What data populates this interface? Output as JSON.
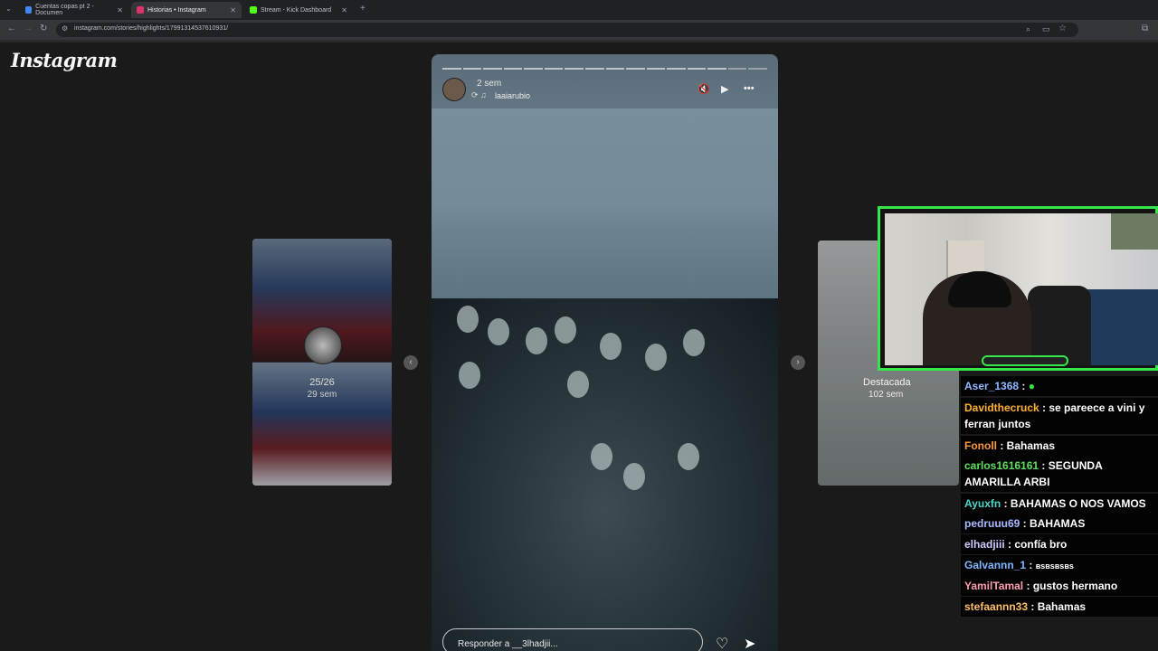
{
  "browser": {
    "tabs": [
      {
        "label": "Cuentas copas pt 2 - Documen",
        "favicon_color": "#4285f4"
      },
      {
        "label": "Historias • Instagram",
        "favicon_color": "#e1306c"
      },
      {
        "label": "Stream - Kick Dashboard",
        "favicon_color": "#53fc18"
      }
    ],
    "url": "instagram.com/stories/highlights/17991314537610931/"
  },
  "instagram": {
    "logo": "Instagram",
    "prev_story": {
      "count": "25/26",
      "time": "29 sem"
    },
    "story": {
      "time": "2 sem",
      "username": "laaiarubio",
      "reply_placeholder": "Responder a __3lhadjii..."
    },
    "next_story": {
      "label": "Destacada",
      "time": "102 sem"
    }
  },
  "chat": {
    "messages": [
      {
        "user": "Aser_1368",
        "text": "",
        "color": "#8fb8ff"
      },
      {
        "user": "Davidthecruck",
        "text": "se pareece a vini y ferran juntos",
        "color": "#ffb02e"
      },
      {
        "user": "Fonoll",
        "text": "Bahamas",
        "color": "#ff9a3c"
      },
      {
        "user": "carlos1616161",
        "text": "SEGUNDA AMARILLA ARBI",
        "color": "#5ee05e"
      },
      {
        "user": "Ayuxfn",
        "text": "BAHAMAS O NOS VAMOS",
        "color": "#4fd6c8"
      },
      {
        "user": "pedruuu69",
        "text": "BAHAMAS",
        "color": "#a9b8ff"
      },
      {
        "user": "elhadjiii",
        "text": "confía bro",
        "color": "#c9c9ff"
      },
      {
        "user": "Galvannn_1",
        "text": "ʙsʙsʙsʙs",
        "color": "#7fb6ff"
      },
      {
        "user": "YamilTamal",
        "text": "gustos hermano",
        "color": "#ff9db0"
      },
      {
        "user": "stefaannn33",
        "text": "Bahamas",
        "color": "#ffbf6a"
      }
    ]
  }
}
